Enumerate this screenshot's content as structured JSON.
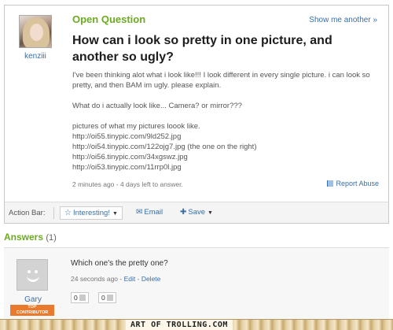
{
  "question": {
    "asker_name": "kenziii",
    "status": "Open Question",
    "show_another": "Show me another »",
    "title": "How can i look so pretty in one picture, and another so ugly?",
    "body_para1": "I've been thinking alot what i look like!!! I look different in every single picture. i can look so pretty, and then BAM im ugly. please explain.",
    "body_para2": "What do i actually look like... Camera? or mirror???",
    "body_para3": "pictures of what my pictures loook like.",
    "links": [
      "http://oi55.tinypic.com/9ld252.jpg",
      "http://oi54.tinypic.com/122ojg7.jpg (the one on the right)",
      "http://oi56.tinypic.com/34xgswz.jpg",
      "http://oi53.tinypic.com/11rrp0l.jpg"
    ],
    "meta": "2 minutes ago - 4 days left to answer.",
    "report_abuse": "Report Abuse"
  },
  "action_bar": {
    "label": "Action Bar:",
    "interesting": "Interesting!",
    "email": "Email",
    "save": "Save"
  },
  "answers": {
    "heading": "Answers",
    "count": "(1)",
    "items": [
      {
        "author": "Gary",
        "badge_line1": "TOP",
        "badge_line2": "CONTRIBUTOR",
        "text": "Which one's the pretty one?",
        "time": "24 seconds ago",
        "edit": "Edit",
        "delete": "Delete",
        "thumbs_up": "0",
        "thumbs_down": "0"
      }
    ]
  },
  "watermark": "ART OF TROLLING.COM",
  "icons": {
    "interesting": "star-icon",
    "email": "envelope-icon",
    "save": "plus-icon",
    "report": "flag-icon"
  },
  "colors": {
    "accent_green": "#6bab1f",
    "link_blue": "#3a6ea5",
    "badge_orange": "#e8792d"
  }
}
